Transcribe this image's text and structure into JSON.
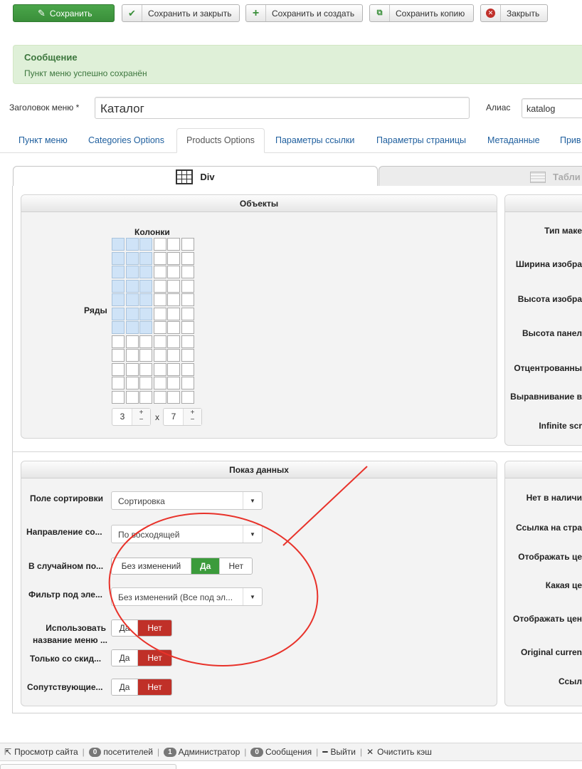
{
  "toolbar": {
    "save": "Сохранить",
    "save_close": "Сохранить и закрыть",
    "save_new": "Сохранить и создать",
    "save_copy": "Сохранить копию",
    "close": "Закрыть"
  },
  "message": {
    "heading": "Сообщение",
    "text": "Пункт меню успешно сохранён"
  },
  "form": {
    "title_label": "Заголовок меню *",
    "title_value": "Каталог",
    "alias_label": "Алиас",
    "alias_value": "katalog"
  },
  "tabs": [
    "Пункт меню",
    "Categories Options",
    "Products Options",
    "Параметры ссылки",
    "Параметры страницы",
    "Метаданные",
    "Прив"
  ],
  "subtabs": {
    "div": "Div",
    "table": "Табли"
  },
  "objects_box": {
    "title": "Объекты",
    "columns_label": "Колонки",
    "rows_label": "Ряды",
    "columns_value": "3",
    "rows_value": "7",
    "times": "x",
    "plus": "+",
    "minus": "−"
  },
  "right_box_top": {
    "labels": [
      "Тип маке",
      "Ширина изобра",
      "Высота изобра",
      "Высота панел",
      "Отцентрованны",
      "Выравнивание в",
      "Infinite scr"
    ]
  },
  "display_box": {
    "title": "Показ данных",
    "sort_field_label": "Поле сортировки",
    "sort_field_value": "Сортировка",
    "direction_label": "Направление со...",
    "direction_value": "По восходящей",
    "random_label": "В случайном по...",
    "random_options": [
      "Без изменений",
      "Да",
      "Нет"
    ],
    "filter_label": "Фильтр под эле...",
    "filter_value": "Без изменений (Все под эл...",
    "menu_name_label_1": "Использовать",
    "menu_name_label_2": "название меню ...",
    "discount_label": "Только со скид...",
    "related_label": "Сопутствующие...",
    "yes": "Да",
    "no": "Нет"
  },
  "right_box_bottom": {
    "labels": [
      "Нет в наличи",
      "Ссылка на стра",
      "Отображать це",
      "Какая це",
      "Отображать цен",
      "Original curren",
      "Ссыл"
    ]
  },
  "statusbar": {
    "view_site": "Просмотр сайта",
    "visitors_count": "0",
    "visitors": "посетителей",
    "admin_count": "1",
    "admin": "Администратор",
    "messages_count": "0",
    "messages": "Сообщения",
    "logout": "Выйти",
    "clear_cache": "Очистить кэш"
  },
  "colors": {
    "save_green": "#3a8f3a",
    "alert_bg": "#dff0d8",
    "selected_cell": "#cfe3f7",
    "toggle_yes": "#3b9b3b",
    "toggle_no": "#c03028",
    "annotation_red": "#e8322a"
  }
}
